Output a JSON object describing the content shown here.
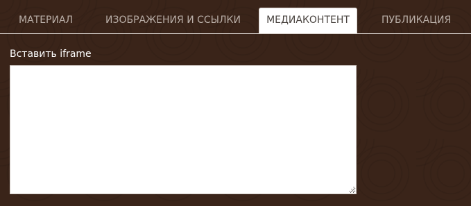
{
  "tabs": [
    {
      "label": "МАТЕРИАЛ",
      "active": false
    },
    {
      "label": "ИЗОБРАЖЕНИЯ И ССЫЛКИ",
      "active": false
    },
    {
      "label": "МЕДИАКОНТЕНТ",
      "active": true
    },
    {
      "label": "ПУБЛИКАЦИЯ",
      "active": false
    }
  ],
  "media": {
    "iframe_label": "Вставить iframe",
    "iframe_value": ""
  },
  "colors": {
    "background": "#3a2419",
    "tab_text": "#b9aea7",
    "active_tab_bg": "#ffffff",
    "active_tab_text": "#4a4440",
    "label_text": "#ffffff"
  }
}
